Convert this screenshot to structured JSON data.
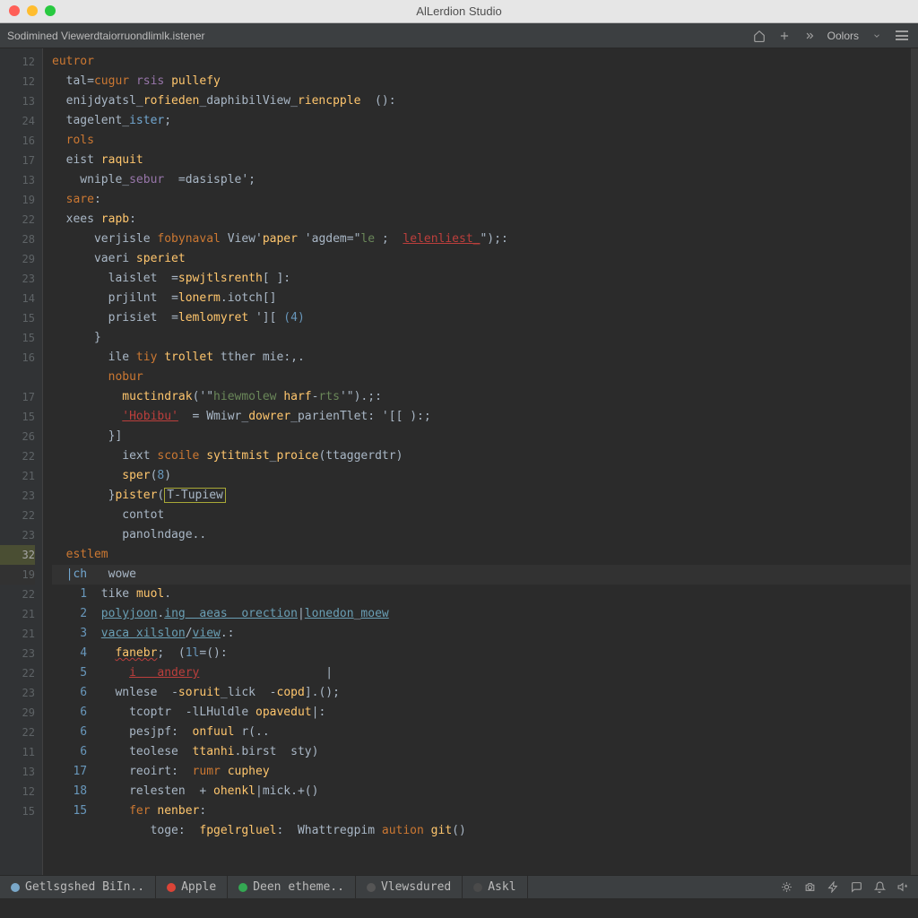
{
  "window": {
    "title": "AlLerdion Studio"
  },
  "toolbar": {
    "breadcrumb": "Sodimined Viewerdtaiorruondlimlk.istener",
    "colors_label": "Oolors",
    "icons": {
      "home": "home-icon",
      "add": "plus-icon",
      "nav": "navigate-icon",
      "dropdown": "chevron-down-icon",
      "menu": "hamburger-icon"
    }
  },
  "gutter": [
    "12",
    "12",
    "13",
    "24",
    "16",
    "17",
    "13",
    "19",
    "22",
    "28",
    "29",
    "23",
    "14",
    "15",
    "15",
    "16",
    "",
    "17",
    "15",
    "26",
    "22",
    "21",
    "23",
    "22",
    "23",
    "32",
    "19",
    "22",
    "21",
    "21",
    "23",
    "22",
    "23",
    "29",
    "22",
    "11",
    "13",
    "12",
    "15"
  ],
  "code": [
    {
      "t": [
        [
          "kw",
          "eutror"
        ]
      ]
    },
    {
      "t": [
        [
          "id",
          "  tal"
        ],
        [
          "op",
          "="
        ],
        [
          "kw",
          "cugur "
        ],
        [
          "vr",
          "rsis "
        ],
        [
          "fn",
          "pullefy"
        ]
      ]
    },
    {
      "t": [
        [
          "id",
          "  enijdyatsl"
        ],
        [
          "op",
          "_"
        ],
        [
          "fn",
          "rofieden"
        ],
        [
          "op",
          "_"
        ],
        [
          "id",
          "daphibilView"
        ],
        [
          "op",
          "_"
        ],
        [
          "fn",
          "riencpple  "
        ],
        [
          "op",
          "():"
        ]
      ]
    },
    {
      "t": [
        [
          "id",
          "  tagelent"
        ],
        [
          "op",
          "_"
        ],
        [
          "hl-id",
          "ister"
        ],
        [
          "op",
          ";"
        ]
      ]
    },
    {
      "t": [
        [
          "kw",
          "  rols"
        ]
      ]
    },
    {
      "t": [
        [
          "id",
          "  eist "
        ],
        [
          "fn",
          "raquit"
        ]
      ]
    },
    {
      "t": [
        [
          "id",
          "    wniple"
        ],
        [
          "op",
          "_"
        ],
        [
          "vr",
          "sebur  "
        ],
        [
          "op",
          "="
        ],
        [
          "id",
          "dasisple"
        ],
        [
          "op",
          "';"
        ]
      ]
    },
    {
      "t": [
        [
          "kw",
          "  sare"
        ],
        [
          "op",
          ":"
        ]
      ]
    },
    {
      "t": [
        [
          "id",
          "  xees "
        ],
        [
          "fn",
          "rapb"
        ],
        [
          "op",
          ":"
        ]
      ]
    },
    {
      "t": [
        [
          "id",
          "      verjisle "
        ],
        [
          "kw",
          "fobynaval "
        ],
        [
          "id",
          "View"
        ],
        [
          "op",
          "'"
        ],
        [
          "fn",
          "paper "
        ],
        [
          "id",
          "'agdem"
        ],
        [
          "op",
          "=\""
        ],
        [
          "st",
          "le "
        ],
        [
          "op",
          ";  "
        ],
        [
          "err-red",
          "lelenliest_"
        ],
        [
          "op",
          "\");:"
        ]
      ]
    },
    {
      "t": [
        [
          "id",
          "      vaeri "
        ],
        [
          "fn",
          "speriet"
        ]
      ]
    },
    {
      "t": [
        [
          "id",
          "        laislet  "
        ],
        [
          "op",
          "="
        ],
        [
          "fn",
          "spwjtlsrenth"
        ],
        [
          "op",
          "[ ]:"
        ]
      ]
    },
    {
      "t": [
        [
          "id",
          "        prjilnt  "
        ],
        [
          "op",
          "="
        ],
        [
          "fn",
          "lonerm"
        ],
        [
          "op",
          "."
        ],
        [
          "id",
          "iotch"
        ],
        [
          "op",
          "[]"
        ]
      ]
    },
    {
      "t": [
        [
          "id",
          "        prisiet  "
        ],
        [
          "op",
          "="
        ],
        [
          "fn",
          "lemlomyret "
        ],
        [
          "op",
          "'][ "
        ],
        [
          "nm",
          "(4)"
        ]
      ]
    },
    {
      "t": [
        [
          "op",
          "      }"
        ]
      ]
    },
    {
      "t": [
        [
          "id",
          "        ile "
        ],
        [
          "kw",
          "tiy "
        ],
        [
          "fn",
          "trollet "
        ],
        [
          "id",
          "tther mie"
        ],
        [
          "op",
          ":,."
        ]
      ]
    },
    {
      "t": [
        [
          "kw",
          "        nobur"
        ]
      ]
    },
    {
      "t": [
        [
          "id",
          "          "
        ],
        [
          "fn",
          "muctindrak"
        ],
        [
          "op",
          "('\""
        ],
        [
          "st",
          "hiewmolew "
        ],
        [
          "fn",
          "harf"
        ],
        [
          "op",
          "-"
        ],
        [
          "st",
          "rts"
        ],
        [
          "op",
          "'\").;:"
        ]
      ]
    },
    {
      "t": [
        [
          "id",
          "          "
        ],
        [
          "err-red",
          "'Hobibu'"
        ],
        [
          "op",
          "  = "
        ],
        [
          "id",
          "Wmiwr"
        ],
        [
          "op",
          "_"
        ],
        [
          "fn",
          "dowrer"
        ],
        [
          "op",
          "_"
        ],
        [
          "id",
          "parienTlet"
        ],
        [
          "op",
          ": '[[ ):;"
        ]
      ]
    },
    {
      "t": [
        [
          "op",
          "        }]"
        ]
      ]
    },
    {
      "t": [
        [
          "id",
          "          iext "
        ],
        [
          "kw",
          "scoile "
        ],
        [
          "fn",
          "sytitmist"
        ],
        [
          "op",
          "_"
        ],
        [
          "fn",
          "proice"
        ],
        [
          "op",
          "("
        ],
        [
          "id",
          "ttaggerdtr"
        ],
        [
          "op",
          ")"
        ]
      ]
    },
    {
      "t": [
        [
          "id",
          "          "
        ],
        [
          "fn",
          "sper"
        ],
        [
          "op",
          "("
        ],
        [
          "nm",
          "8"
        ],
        [
          "op",
          ")"
        ]
      ]
    },
    {
      "t": [
        [
          "op",
          "        }"
        ],
        [
          "fn",
          "pister"
        ],
        [
          "op",
          "("
        ],
        [
          "box",
          "T-Tupiew"
        ],
        [
          "op",
          ""
        ]
      ]
    },
    {
      "t": [
        [
          "id",
          "          contot"
        ]
      ]
    },
    {
      "t": [
        [
          "id",
          "          panolndage"
        ],
        [
          "op",
          ".."
        ]
      ]
    },
    {
      "t": [
        [
          "kw",
          "  estlem"
        ]
      ],
      "marker": true
    },
    {
      "t": [
        [
          "hl-id",
          "  |ch   "
        ],
        [
          "id",
          "wowe"
        ]
      ],
      "caret": true
    },
    {
      "t": [
        [
          "nm",
          "    1  "
        ],
        [
          "id",
          "tike "
        ],
        [
          "fn",
          "muol"
        ],
        [
          "op",
          "."
        ]
      ]
    },
    {
      "t": [
        [
          "nm",
          "    2  "
        ],
        [
          "link",
          "polyjoon"
        ],
        [
          "op",
          "."
        ],
        [
          "link",
          "ing  aeas  orection"
        ],
        [
          "op",
          "|"
        ],
        [
          "link",
          "lonedon"
        ],
        [
          "op",
          "_"
        ],
        [
          "link",
          "moew"
        ]
      ]
    },
    {
      "t": [
        [
          "nm",
          "    3  "
        ],
        [
          "link",
          "vaca xilslon"
        ],
        [
          "op",
          "/"
        ],
        [
          "link",
          "view"
        ],
        [
          "op",
          ".:"
        ]
      ]
    },
    {
      "t": [
        [
          "nm",
          "    4    "
        ],
        [
          "err",
          "fanebr"
        ],
        [
          "op",
          ";  ("
        ],
        [
          "nm",
          "1l"
        ],
        [
          "op",
          "=():"
        ]
      ]
    },
    {
      "t": [
        [
          "nm",
          "    5      "
        ],
        [
          "err-red",
          "i   andery"
        ],
        [
          "id",
          "                  |"
        ]
      ]
    },
    {
      "t": [
        [
          "nm",
          "    6    "
        ],
        [
          "id",
          "wnlese  "
        ],
        [
          "op",
          "-"
        ],
        [
          "fn",
          "soruit"
        ],
        [
          "op",
          "_"
        ],
        [
          "id",
          "lick  "
        ],
        [
          "op",
          "-"
        ],
        [
          "fn",
          "copd"
        ],
        [
          "op",
          "].();"
        ]
      ]
    },
    {
      "t": [
        [
          "nm",
          "    6      "
        ],
        [
          "id",
          "tcoptr  "
        ],
        [
          "op",
          "-"
        ],
        [
          "id",
          "lLHuldle "
        ],
        [
          "fn",
          "opavedut"
        ],
        [
          "op",
          "|:"
        ]
      ]
    },
    {
      "t": [
        [
          "nm",
          "    6      "
        ],
        [
          "id",
          "pesjpf"
        ],
        [
          "op",
          ":  "
        ],
        [
          "fn",
          "onfuul "
        ],
        [
          "id",
          "r"
        ],
        [
          "op",
          "(.."
        ]
      ]
    },
    {
      "t": [
        [
          "nm",
          "    6      "
        ],
        [
          "id",
          "teolese  "
        ],
        [
          "fn",
          "ttanhi"
        ],
        [
          "op",
          "."
        ],
        [
          "id",
          "birst  sty"
        ],
        [
          "op",
          ")"
        ]
      ]
    },
    {
      "t": [
        [
          "nm",
          "   17      "
        ],
        [
          "id",
          "reoirt"
        ],
        [
          "op",
          ":  "
        ],
        [
          "kw",
          "rumr "
        ],
        [
          "fn",
          "cuphey"
        ]
      ]
    },
    {
      "t": [
        [
          "nm",
          "   18      "
        ],
        [
          "id",
          "relesten  "
        ],
        [
          "op",
          "+ "
        ],
        [
          "fn",
          "ohenkl"
        ],
        [
          "op",
          "|"
        ],
        [
          "id",
          "mick"
        ],
        [
          "op",
          ".+"
        ],
        [
          "op",
          "()"
        ]
      ]
    },
    {
      "t": [
        [
          "nm",
          "   15      "
        ],
        [
          "kw",
          "fer "
        ],
        [
          "fn",
          "nenber"
        ],
        [
          "op",
          ":"
        ]
      ]
    },
    {
      "t": [
        [
          "id",
          "              toge"
        ],
        [
          "op",
          ":  "
        ],
        [
          "fn",
          "fpgelrgluel"
        ],
        [
          "op",
          ":  "
        ],
        [
          "id",
          "Whattregpim "
        ],
        [
          "kw",
          "aution "
        ],
        [
          "fn",
          "git"
        ],
        [
          "op",
          "()"
        ]
      ]
    }
  ],
  "status": {
    "tabs": [
      {
        "label": "Getlsgshed BiIn..",
        "icon": "circle-outline",
        "color": "#7aa8c9"
      },
      {
        "label": "Apple",
        "icon": "circle-g",
        "color": "#db4437"
      },
      {
        "label": "Deen etheme..",
        "icon": "circle-d",
        "color": "#34a853"
      },
      {
        "label": "Vlewsdured",
        "icon": "circle-i",
        "color": "#555555"
      },
      {
        "label": "Askl",
        "icon": "circle-a",
        "color": "#4a4a4a"
      }
    ],
    "icons": [
      "gear-icon",
      "camera-icon",
      "lightning-icon",
      "chat-icon",
      "bell-icon",
      "speaker-icon"
    ]
  },
  "colors": {
    "accent": "#ffc66d",
    "error": "#bc3f3c"
  }
}
